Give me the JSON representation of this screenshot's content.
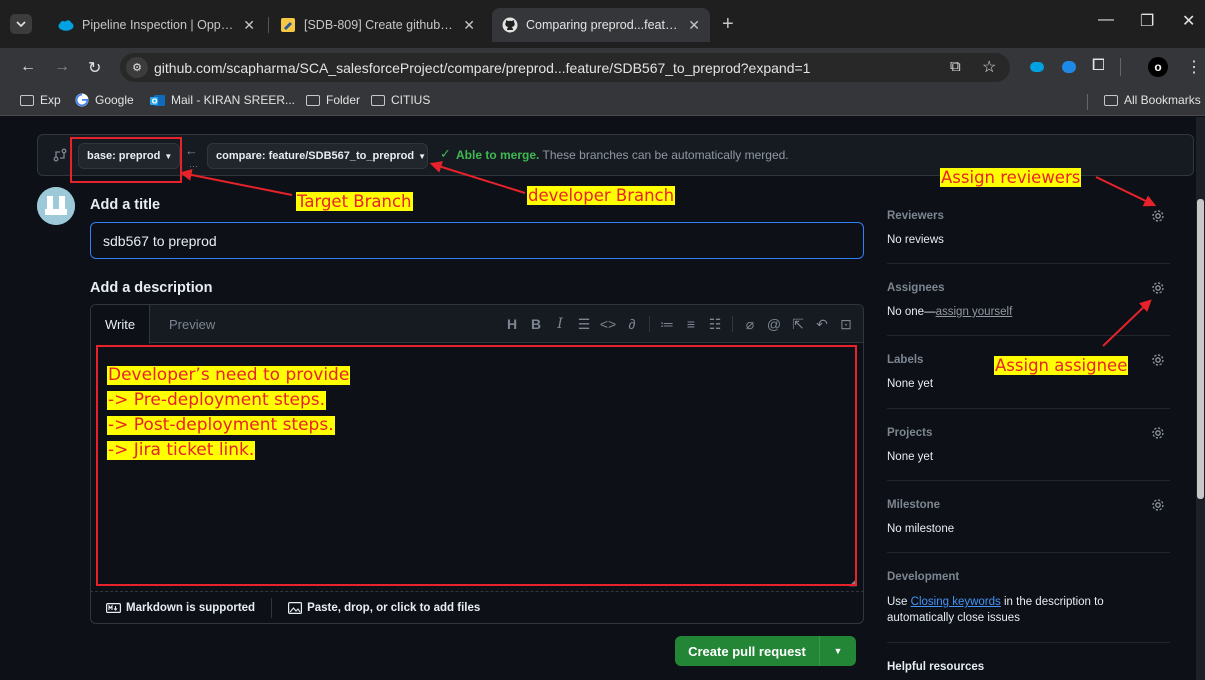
{
  "tabs": [
    {
      "title": "Pipeline Inspection | Opportuni",
      "favicon": "salesforce-cloud-icon"
    },
    {
      "title": "[SDB-809] Create github user in",
      "favicon": "jira-icon"
    },
    {
      "title": "Comparing preprod...feature/SD",
      "favicon": "github-icon",
      "active": true
    }
  ],
  "toolbar": {
    "url": "github.com/scapharma/SCA_salesforceProject/compare/preprod...feature/SDB567_to_preprod?expand=1"
  },
  "bookmarks": {
    "items": [
      "Exp",
      "Google",
      "Mail - KIRAN SREER...",
      "Folder",
      "CITIUS"
    ],
    "all_label": "All Bookmarks"
  },
  "compare": {
    "base_label": "base: preprod",
    "compare_label": "compare: feature/SDB567_to_preprod",
    "merge_ok": "Able to merge.",
    "merge_text": "These branches can be automatically merged."
  },
  "form": {
    "title_heading": "Add a title",
    "title_value": "sdb567 to preprod",
    "desc_heading": "Add a description",
    "tab_write": "Write",
    "tab_preview": "Preview",
    "markdown_note": "Markdown is supported",
    "attach_note": "Paste, drop, or click to add files",
    "create_button": "Create pull request"
  },
  "sidebar": {
    "reviewers_label": "Reviewers",
    "reviewers_value": "No reviews",
    "assignees_label": "Assignees",
    "assignees_prefix": "No one—",
    "assignees_link": "assign yourself",
    "labels_label": "Labels",
    "labels_value": "None yet",
    "projects_label": "Projects",
    "projects_value": "None yet",
    "milestone_label": "Milestone",
    "milestone_value": "No milestone",
    "development_label": "Development",
    "dev_prefix": "Use ",
    "dev_link": "Closing keywords",
    "dev_suffix": " in the description to",
    "dev_line2": "automatically close issues",
    "helpful_label": "Helpful resources"
  },
  "annotations": {
    "target_branch": "Target Branch",
    "developer_branch": "developer Branch",
    "assign_reviewers": "Assign reviewers",
    "assign_assignee": "Assign assignee",
    "note_lines": [
      "Developer’s need to provide",
      "-> Pre-deployment steps.",
      "-> Post-deployment steps.",
      "-> Jira ticket link."
    ]
  },
  "colors": {
    "accent_blue": "#2f81f7",
    "success_green": "#238636",
    "annotation_red": "#e8222a",
    "annotation_yellow": "#ffff00"
  }
}
